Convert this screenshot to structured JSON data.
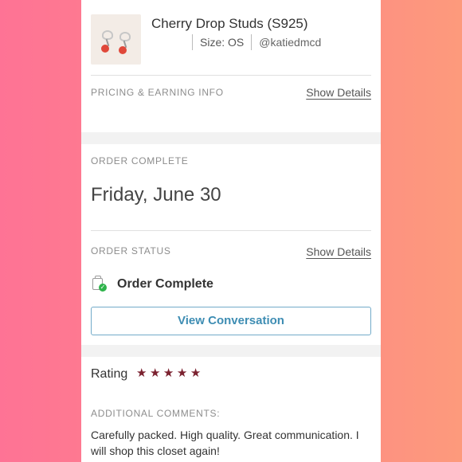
{
  "item": {
    "title": "Cherry Drop Studs (S925)",
    "size": "Size: OS",
    "seller": "@katiedmcd"
  },
  "pricing": {
    "label": "PRICING & EARNING INFO",
    "link": "Show Details"
  },
  "order": {
    "complete_label": "ORDER COMPLETE",
    "date": "Friday, June 30",
    "status_label": "ORDER STATUS",
    "status_link": "Show Details",
    "status_text": "Order Complete",
    "status_icon": "order-complete-icon",
    "button": "View Conversation"
  },
  "rating": {
    "label": "Rating",
    "stars": 5,
    "max_stars": 5,
    "star_color": "#7b2230",
    "comments_label": "ADDITIONAL COMMENTS:",
    "comment": "Carefully packed. High quality. Great communication. I will shop this closet again!"
  },
  "colors": {
    "button_border": "#72abc9",
    "button_text": "#3e8db3",
    "status_check": "#2eb34b"
  }
}
